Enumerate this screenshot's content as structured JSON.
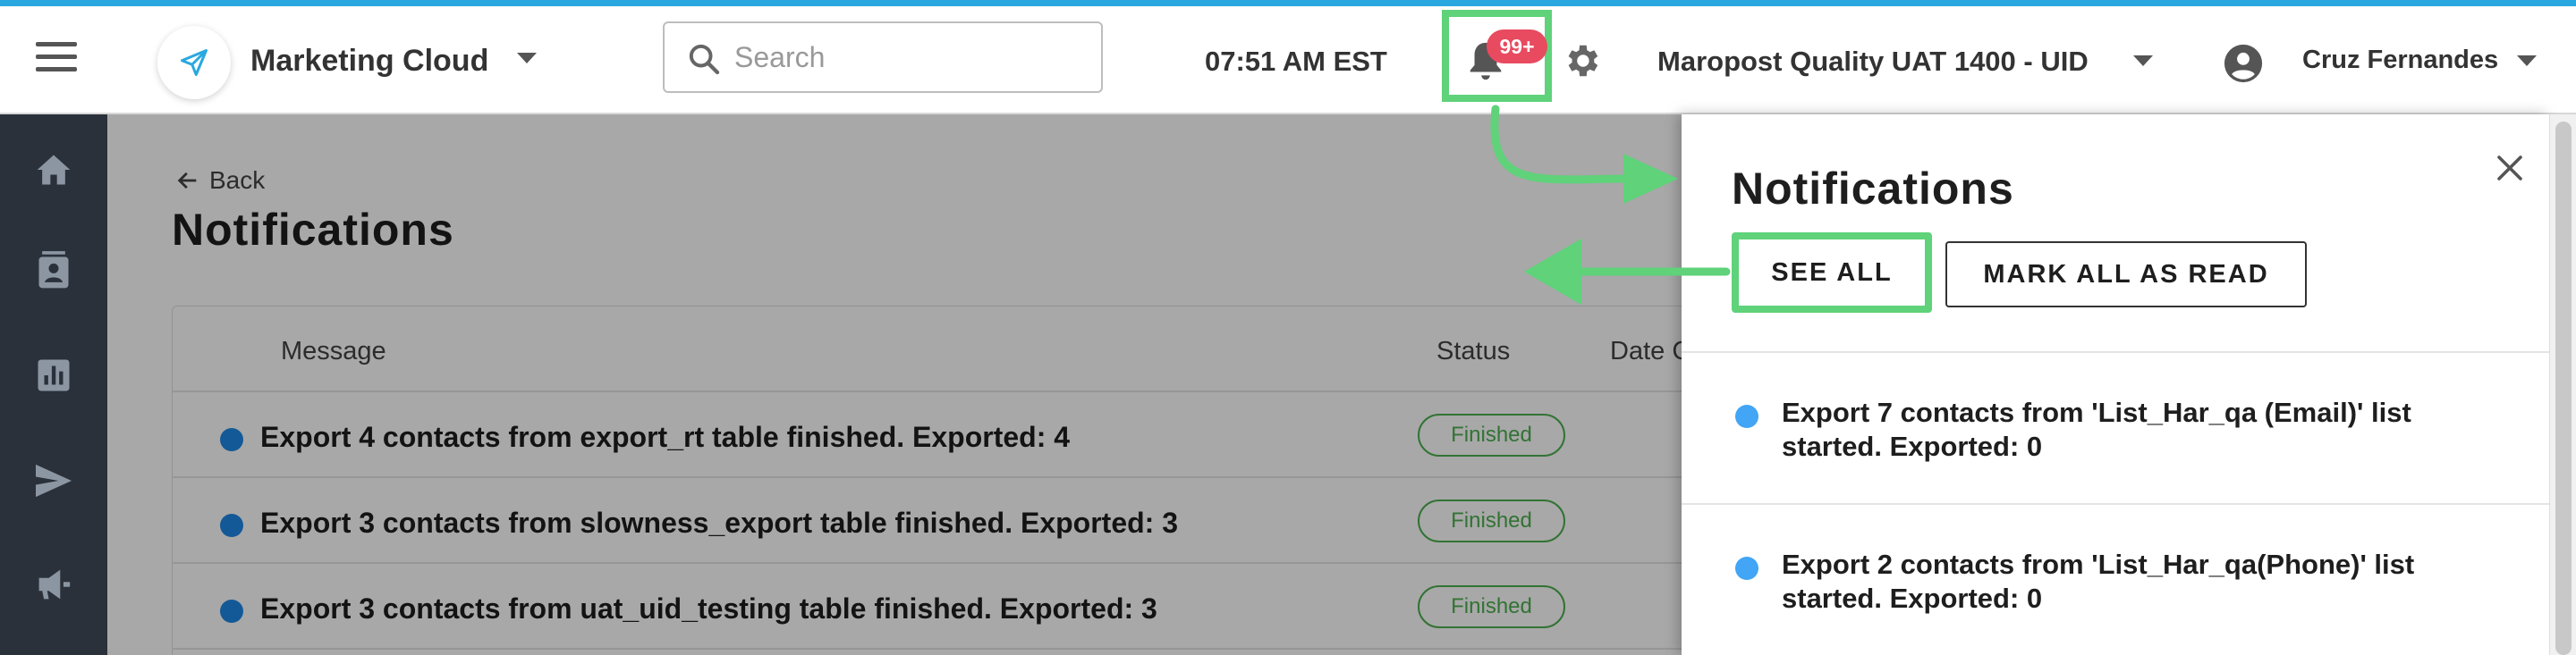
{
  "header": {
    "app_name": "Marketing Cloud",
    "search_placeholder": "Search",
    "time": "07:51 AM EST",
    "notification_badge": "99+",
    "account_name": "Maropost Quality UAT 1400 - UID",
    "user_name": "Cruz Fernandes"
  },
  "sidebar": {
    "items": [
      {
        "icon": "home-icon"
      },
      {
        "icon": "contacts-icon"
      },
      {
        "icon": "reports-icon"
      },
      {
        "icon": "send-icon"
      },
      {
        "icon": "megaphone-icon"
      }
    ]
  },
  "main": {
    "back_label": "Back",
    "title": "Notifications",
    "columns": [
      "Message",
      "Status",
      "Date C"
    ],
    "rows": [
      {
        "message": "Export 4 contacts from export_rt table finished. Exported: 4",
        "status": "Finished"
      },
      {
        "message": "Export 3 contacts from slowness_export table finished. Exported: 3",
        "status": "Finished"
      },
      {
        "message": "Export 3 contacts from uat_uid_testing table finished. Exported: 3",
        "status": "Finished"
      }
    ]
  },
  "panel": {
    "title": "Notifications",
    "see_all": "SEE ALL",
    "mark_all_read": "MARK ALL AS READ",
    "items": [
      {
        "text": "Export 7 contacts from 'List_Har_qa (Email)' list started. Exported: 0"
      },
      {
        "text": "Export 2 contacts from 'List_Har_qa(Phone)' list started. Exported: 0"
      }
    ]
  },
  "colors": {
    "accent_bar": "#29a8e0",
    "highlight": "#5fd27a",
    "badge": "#e84a5f",
    "unread_dot": "#42a5f5",
    "status_finished": "#4caf50",
    "sidebar_bg": "#2a313b"
  }
}
